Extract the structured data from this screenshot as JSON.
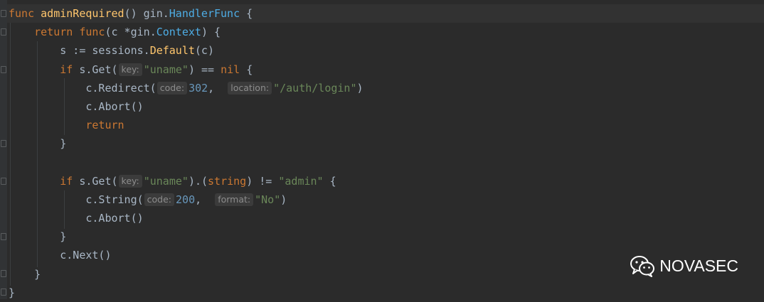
{
  "code": {
    "lines": [
      {
        "segments": [
          {
            "t": "func",
            "c": "kw"
          },
          {
            "t": " ",
            "c": ""
          },
          {
            "t": "adminRequired",
            "c": "fn"
          },
          {
            "t": "() ",
            "c": ""
          },
          {
            "t": "gin",
            "c": "pkg"
          },
          {
            "t": ".",
            "c": ""
          },
          {
            "t": "HandlerFunc",
            "c": "ty"
          },
          {
            "t": " {",
            "c": ""
          }
        ]
      },
      {
        "segments": [
          {
            "t": "    ",
            "c": ""
          },
          {
            "t": "return",
            "c": "kw"
          },
          {
            "t": " ",
            "c": ""
          },
          {
            "t": "func",
            "c": "kw"
          },
          {
            "t": "(c *",
            "c": ""
          },
          {
            "t": "gin",
            "c": "pkg"
          },
          {
            "t": ".",
            "c": ""
          },
          {
            "t": "Context",
            "c": "ty"
          },
          {
            "t": ") {",
            "c": ""
          }
        ]
      },
      {
        "segments": [
          {
            "t": "        s := ",
            "c": ""
          },
          {
            "t": "sessions",
            "c": "pkg"
          },
          {
            "t": ".",
            "c": ""
          },
          {
            "t": "Default",
            "c": "fn2"
          },
          {
            "t": "(c)",
            "c": ""
          }
        ]
      },
      {
        "segments": [
          {
            "t": "        ",
            "c": ""
          },
          {
            "t": "if",
            "c": "kw"
          },
          {
            "t": " s.Get(",
            "c": ""
          },
          {
            "t": "key:",
            "c": "hint"
          },
          {
            "t": "\"uname\"",
            "c": "str"
          },
          {
            "t": ") == ",
            "c": ""
          },
          {
            "t": "nil",
            "c": "kw"
          },
          {
            "t": " {",
            "c": ""
          }
        ]
      },
      {
        "segments": [
          {
            "t": "            c.Redirect(",
            "c": ""
          },
          {
            "t": "code:",
            "c": "hint"
          },
          {
            "t": "302",
            "c": "num"
          },
          {
            "t": ",  ",
            "c": ""
          },
          {
            "t": "location:",
            "c": "hint"
          },
          {
            "t": "\"/auth/login\"",
            "c": "str"
          },
          {
            "t": ")",
            "c": ""
          }
        ]
      },
      {
        "segments": [
          {
            "t": "            c.Abort()",
            "c": ""
          }
        ]
      },
      {
        "segments": [
          {
            "t": "            ",
            "c": ""
          },
          {
            "t": "return",
            "c": "kw"
          }
        ]
      },
      {
        "segments": [
          {
            "t": "        }",
            "c": ""
          }
        ]
      },
      {
        "segments": [
          {
            "t": "",
            "c": ""
          }
        ]
      },
      {
        "segments": [
          {
            "t": "        ",
            "c": ""
          },
          {
            "t": "if",
            "c": "kw"
          },
          {
            "t": " s.Get(",
            "c": ""
          },
          {
            "t": "key:",
            "c": "hint"
          },
          {
            "t": "\"uname\"",
            "c": "str"
          },
          {
            "t": ").(",
            "c": ""
          },
          {
            "t": "string",
            "c": "kw"
          },
          {
            "t": ") != ",
            "c": ""
          },
          {
            "t": "\"admin\"",
            "c": "str"
          },
          {
            "t": " {",
            "c": ""
          }
        ]
      },
      {
        "segments": [
          {
            "t": "            c.String(",
            "c": ""
          },
          {
            "t": "code:",
            "c": "hint"
          },
          {
            "t": "200",
            "c": "num"
          },
          {
            "t": ",  ",
            "c": ""
          },
          {
            "t": "format:",
            "c": "hint"
          },
          {
            "t": "\"No\"",
            "c": "str"
          },
          {
            "t": ")",
            "c": ""
          }
        ]
      },
      {
        "segments": [
          {
            "t": "            c.Abort()",
            "c": ""
          }
        ]
      },
      {
        "segments": [
          {
            "t": "        }",
            "c": ""
          }
        ]
      },
      {
        "segments": [
          {
            "t": "        c.Next()",
            "c": ""
          }
        ]
      },
      {
        "segments": [
          {
            "t": "    }",
            "c": ""
          }
        ]
      },
      {
        "segments": [
          {
            "t": "}",
            "c": ""
          }
        ]
      }
    ]
  },
  "watermark": {
    "text": "NOVASEC",
    "icon": "wechat-icon"
  },
  "colors": {
    "background": "#2b2b2b",
    "keyword": "#cc7832",
    "function": "#ffc66d",
    "type": "#4eade5",
    "string": "#6a8759",
    "number": "#6897bb",
    "text": "#a9b7c6"
  }
}
